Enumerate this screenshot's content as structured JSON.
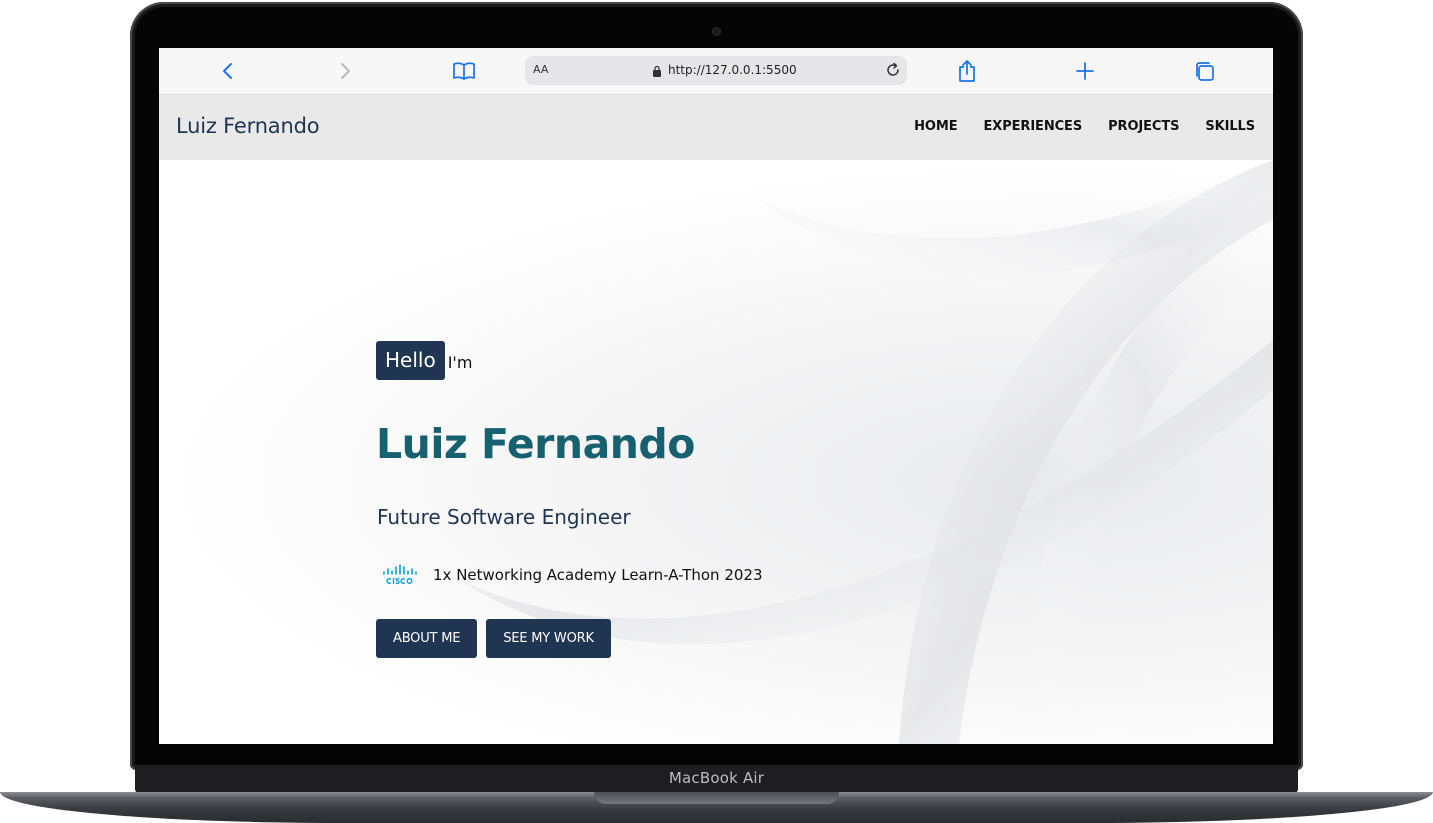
{
  "device": {
    "label": "MacBook Air"
  },
  "browser": {
    "text_size_label": "AA",
    "url": "http://127.0.0.1:5500",
    "icons": [
      "chevron-left-icon",
      "chevron-right-icon",
      "book-icon",
      "lock-icon",
      "reload-icon",
      "share-icon",
      "plus-icon",
      "tabs-icon"
    ],
    "accent_color": "#1a73e8"
  },
  "header": {
    "brand": "Luiz Fernando",
    "nav": [
      "HOME",
      "EXPERIENCES",
      "PROJECTS",
      "SKILLS"
    ]
  },
  "hero": {
    "greeting_badge": "Hello",
    "greeting_suffix": "I'm",
    "name": "Luiz Fernando",
    "role": "Future Software Engineer",
    "award_icon": "cisco-logo",
    "award_text": "1x Networking Academy Learn-A-Thon 2023",
    "buttons": {
      "about": "ABOUT ME",
      "work": "SEE MY WORK"
    }
  },
  "colors": {
    "navy": "#1f3552",
    "teal": "#17606f",
    "header_bg": "#e9e9e9",
    "cisco_blue": "#049fd9"
  }
}
